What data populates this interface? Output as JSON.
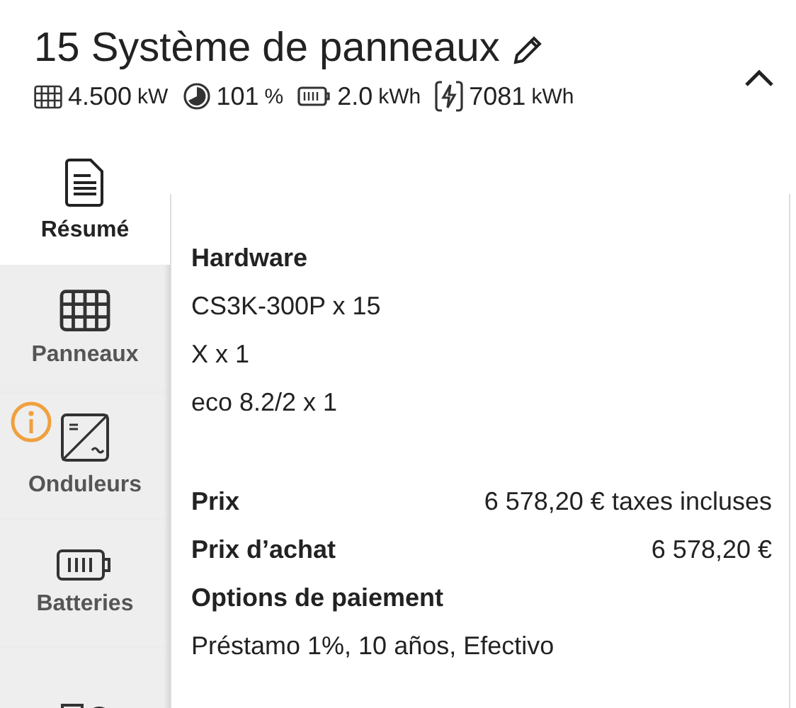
{
  "header": {
    "title": "15 Système de panneaux",
    "expanded": true,
    "stats": [
      {
        "kind": "panel",
        "value": "4.500",
        "unit": "kW"
      },
      {
        "kind": "ratio",
        "value": "101",
        "unit": "%"
      },
      {
        "kind": "battery",
        "value": "2.0",
        "unit": "kWh"
      },
      {
        "kind": "energy",
        "value": "7081",
        "unit": "kWh"
      }
    ]
  },
  "tabs": [
    {
      "kind": "summary",
      "label": "Résumé",
      "selected": true,
      "warning": false
    },
    {
      "kind": "panels",
      "label": "Panneaux",
      "selected": false,
      "warning": false
    },
    {
      "kind": "inverter",
      "label": "Onduleurs",
      "selected": false,
      "warning": true
    },
    {
      "kind": "battery",
      "label": "Batteries",
      "selected": false,
      "warning": false
    },
    {
      "kind": "devices",
      "selected": false,
      "warning": false
    }
  ],
  "summary": {
    "hardware_title": "Hardware",
    "hardware": [
      "CS3K-300P x 15",
      "X x 1",
      "eco 8.2/2 x 1"
    ],
    "prices": [
      {
        "label": "Prix",
        "value": "6 578,20 € taxes incluses"
      },
      {
        "label": "Prix d’achat",
        "value": "6 578,20 €"
      }
    ],
    "payment_title": "Options de paiement",
    "payment": "Préstamo 1%, 10 años, Efectivo"
  }
}
